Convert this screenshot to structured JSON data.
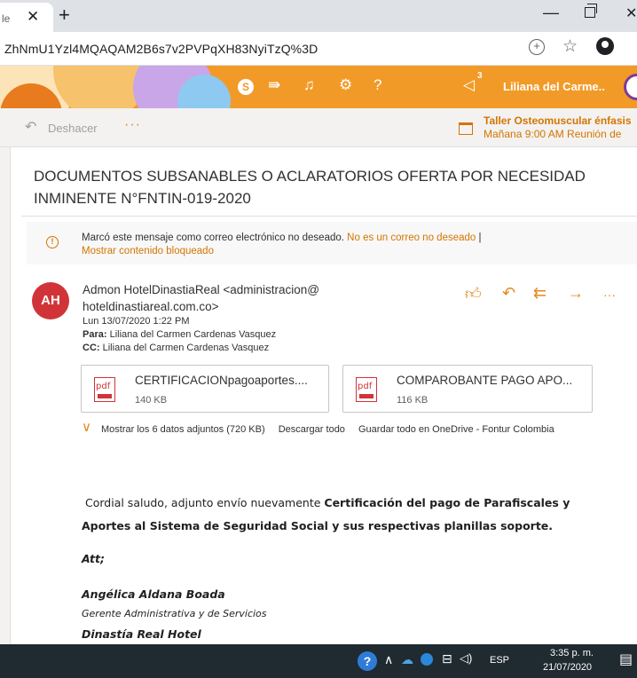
{
  "browser": {
    "tab_title": "le",
    "url": "ZhNmU1Yzl4MQAQAM2B6s7v2PVPqXH83NyiTzQ%3D"
  },
  "outlook_header": {
    "user_name": "Liliana del Carme..",
    "notification_count": "3"
  },
  "command_bar": {
    "undo_label": "Deshacer",
    "more": "···",
    "event_title": "Taller Osteomuscular énfasis",
    "event_time": "Mañana 9:00 AM Reunión de"
  },
  "message": {
    "subject": "DOCUMENTOS SUBSANABLES O ACLARATORIOS OFERTA POR NECESIDAD INMINENTE N°FNTIN-019-2020",
    "junk_notice": "Marcó este mensaje como correo electrónico no deseado.",
    "not_junk_link": "No es un correo no deseado",
    "junk_separator": "|",
    "show_blocked_link": "Mostrar contenido bloqueado",
    "avatar_initials": "AH",
    "sender": "Admon HotelDinastiaReal <administracion@ hoteldinastiareal.com.co>",
    "date": "Lun 13/07/2020 1:22 PM",
    "to_label": "Para:",
    "to": "Liliana del Carmen Cardenas Vasquez",
    "cc_label": "CC:",
    "cc": "Liliana del Carmen Cardenas Vasquez",
    "more_actions": "···"
  },
  "attachments": {
    "items": [
      {
        "name": "CERTIFICACIONpagoaportes....",
        "size": "140 KB",
        "icon_label": "pdf"
      },
      {
        "name": "COMPAROBANTE PAGO APO...",
        "size": "116 KB",
        "icon_label": "pdf"
      }
    ],
    "show_all": "Mostrar los 6 datos adjuntos (720 KB)",
    "download_all": "Descargar todo",
    "save_onedrive": "Guardar todo en OneDrive - Fontur Colombia"
  },
  "body": {
    "greeting": "Cordial saludo, adjunto envío nuevamente",
    "bold_part1": "Certificación del pago de Parafiscales y",
    "bold_part2": "Aportes al Sistema de Seguridad Social y sus respectivas planillas soporte.",
    "att": "Att;",
    "signer_name": "Angélica Aldana Boada",
    "signer_title": "Gerente Administrativa y de Servicios",
    "company": "Dinastía Real Hotel"
  },
  "taskbar": {
    "language": "ESP",
    "time": "3:35 p. m.",
    "date": "21/07/2020"
  },
  "colors": {
    "header_orange": "#f29a27",
    "accent_orange": "#d47500",
    "avatar_red": "#d13438",
    "taskbar": "#1f2a31"
  }
}
